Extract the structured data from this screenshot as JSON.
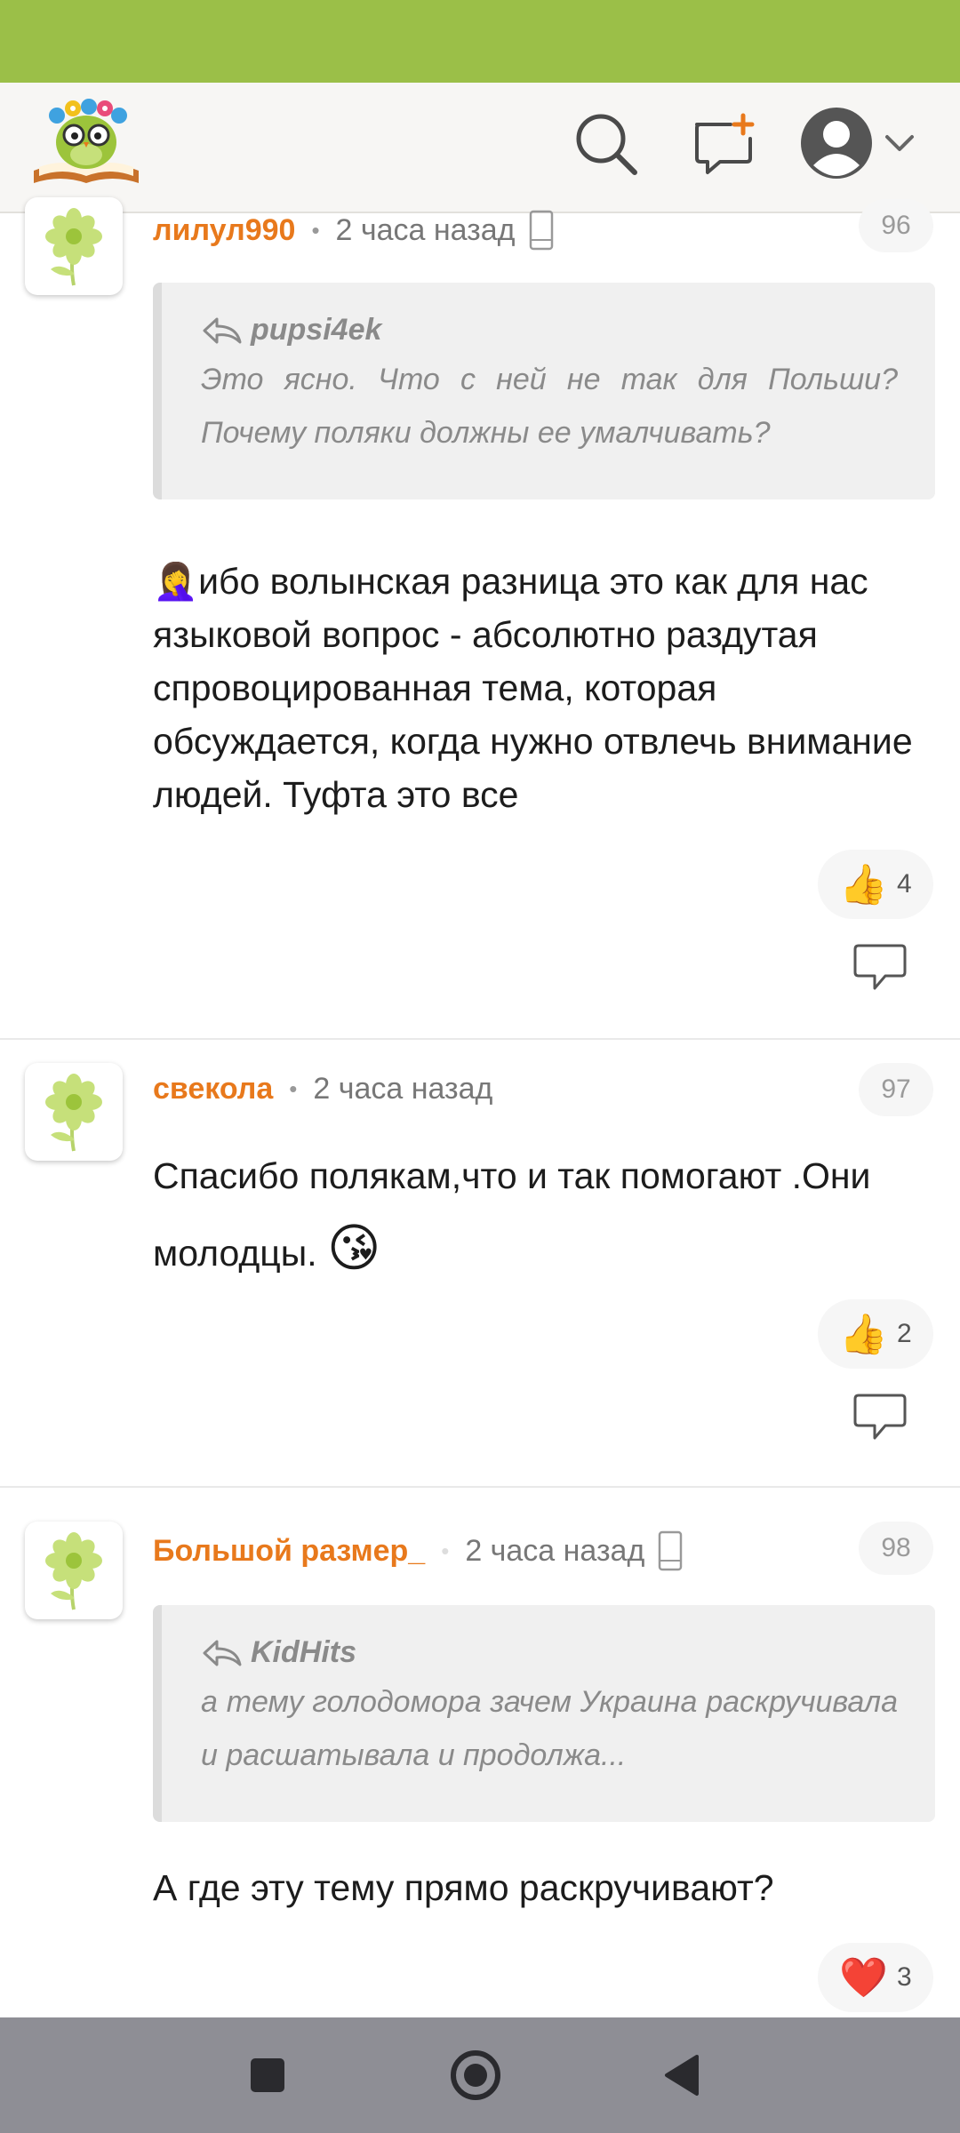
{
  "header": {
    "logo": "owl-with-flowers-and-book-logo",
    "icons": [
      "search-icon",
      "new-post-icon",
      "user-avatar-icon",
      "chevron-down-icon"
    ]
  },
  "comments": [
    {
      "author": "лилул990",
      "time": "2 часа назад",
      "number": "96",
      "device": "mobile-phone-icon",
      "quote": {
        "author": "pupsi4ek",
        "text": "Это ясно. Что с ней не так для Польши? Почему поляки должны ее умалчивать?"
      },
      "emoji": "🤦‍♀️",
      "text": "ибо волынская разница это как для нас языковой вопрос - абсолютно раздутая спровоцированная тема, которая обсуждается, когда нужно отвлечь внимание людей. Туфта это все",
      "reaction_emoji": "👍",
      "reaction_count": "4"
    },
    {
      "author": "свекола",
      "time": "2 часа назад",
      "number": "97",
      "text": "Спасибо полякам,что и так помогают .Они молодцы.",
      "emoji": "😘",
      "reaction_emoji": "👍",
      "reaction_count": "2"
    },
    {
      "author": "Большой размер_",
      "time": "2 часа назад",
      "number": "98",
      "device": "mobile-phone-icon",
      "quote": {
        "author": "KidHits",
        "text": "а тему голодомора зачем Украина раскручивала и расшатывала и продолжа..."
      },
      "text": "А где эту тему прямо раскручивают?",
      "reaction_emoji": "❤️",
      "reaction_count": "3"
    }
  ],
  "navbar": {
    "icons": [
      "recent-apps-icon",
      "home-icon",
      "back-icon"
    ]
  },
  "colors": {
    "status_bar": "#9bbf48",
    "author": "#e8791c",
    "nav_bar": "#8e8e95"
  }
}
